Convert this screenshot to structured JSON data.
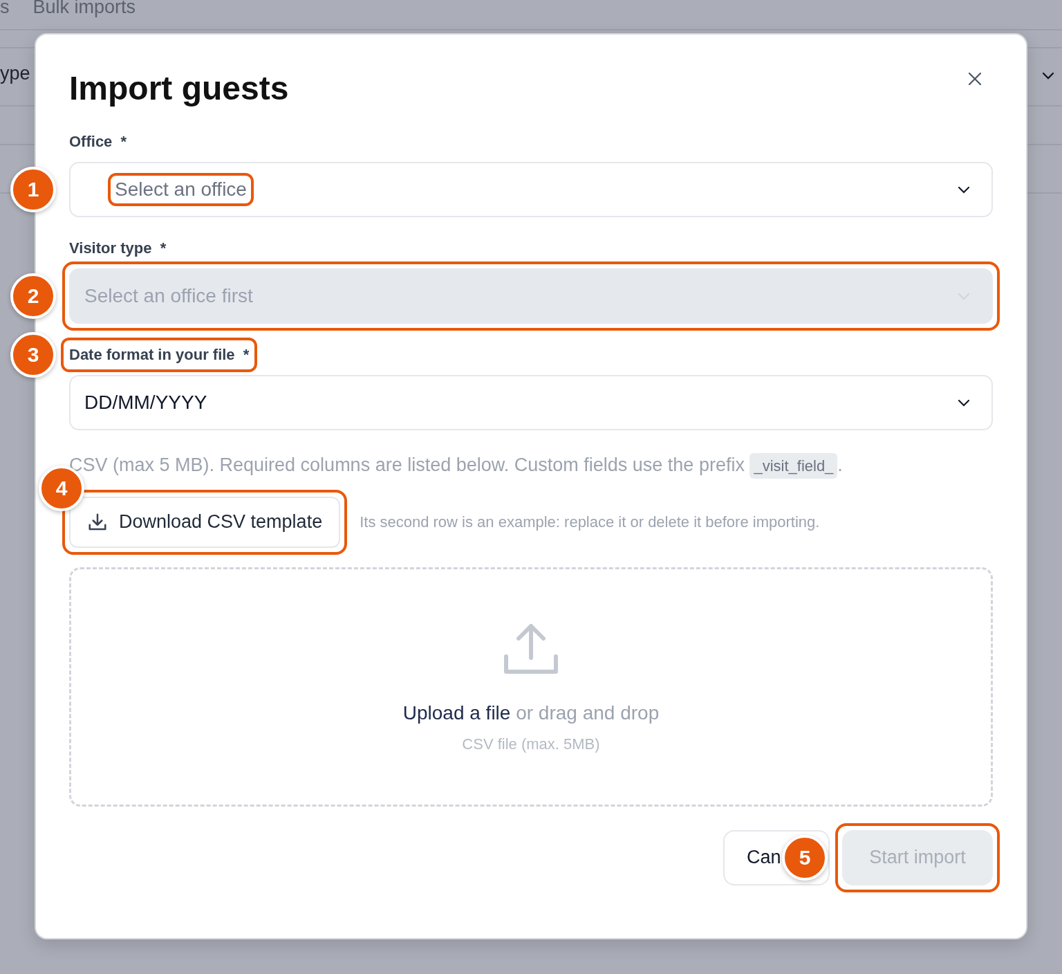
{
  "background": {
    "tabs": [
      {
        "label": "s"
      },
      {
        "label": "Bulk imports"
      }
    ],
    "row_label": "ype"
  },
  "dialog": {
    "title": "Import guests",
    "fields": [
      {
        "label": "Office",
        "required_mark": "*",
        "placeholder": "Select an office",
        "disabled": false,
        "label_highlighted": false,
        "control_highlighted": false,
        "text_highlighted": true,
        "marker": "1"
      },
      {
        "label": "Visitor type",
        "required_mark": "*",
        "placeholder": "Select an office first",
        "disabled": true,
        "label_highlighted": false,
        "control_highlighted": true,
        "text_highlighted": false,
        "marker": "2"
      },
      {
        "label": "Date format in your file",
        "required_mark": "*",
        "value": "DD/MM/YYYY",
        "disabled": false,
        "label_highlighted": true,
        "control_highlighted": false,
        "text_highlighted": false,
        "marker": "3"
      }
    ],
    "hint": {
      "before": "CSV (max 5 MB). Required columns are listed below. Custom fields use the prefix ",
      "code": "_visit_field_",
      "after": "."
    },
    "download": {
      "label": "Download CSV template",
      "highlighted": true,
      "marker": "4",
      "note": "Its second row is an example: replace it or delete it before importing."
    },
    "dropzone": {
      "link": "Upload a file",
      "text": "or drag and drop",
      "subtext": "CSV file (max. 5MB)"
    },
    "buttons": [
      {
        "kind": "secondary",
        "label": "Can",
        "disabled": false,
        "highlighted": false,
        "marker": "5"
      },
      {
        "kind": "primary",
        "label": "Start import",
        "disabled": true,
        "highlighted": true
      }
    ]
  }
}
